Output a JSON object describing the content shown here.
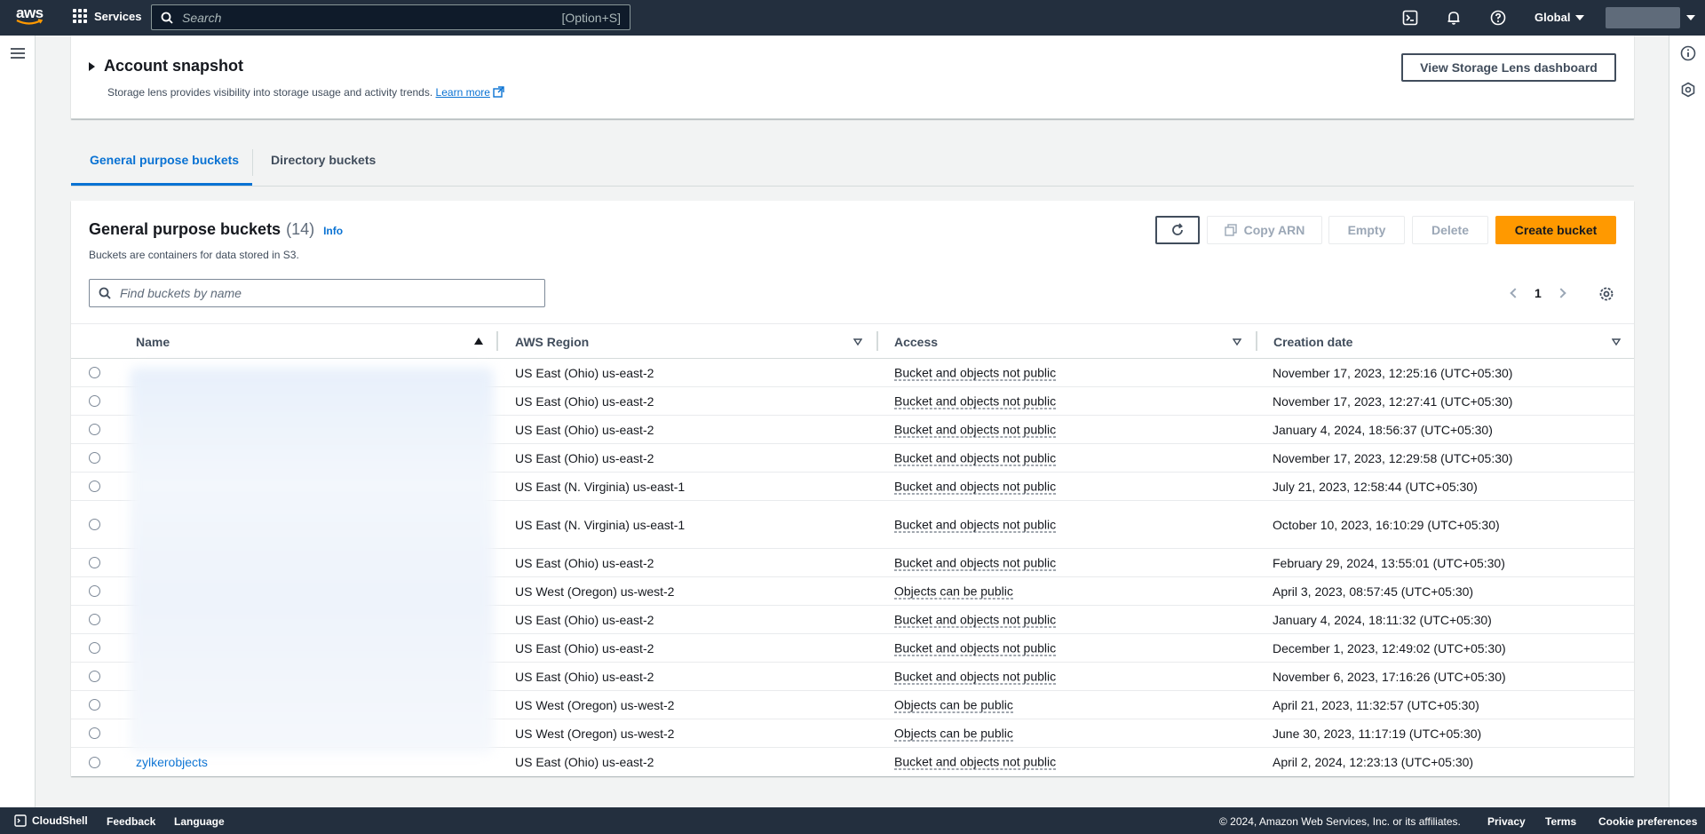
{
  "topnav": {
    "logo_text": "aws",
    "services_label": "Services",
    "search_placeholder": "Search",
    "search_shortcut": "[Option+S]",
    "region_label": "Global"
  },
  "snapshot": {
    "title": "Account snapshot",
    "description": "Storage lens provides visibility into storage usage and activity trends.",
    "learn_more": "Learn more",
    "dashboard_button": "View Storage Lens dashboard"
  },
  "tabs": [
    {
      "label": "General purpose buckets",
      "active": true
    },
    {
      "label": "Directory buckets",
      "active": false
    }
  ],
  "panel": {
    "title": "General purpose buckets",
    "count": "(14)",
    "info": "Info",
    "description": "Buckets are containers for data stored in S3.",
    "filter_placeholder": "Find buckets by name",
    "page": "1",
    "buttons": {
      "copy_arn": "Copy ARN",
      "empty": "Empty",
      "delete": "Delete",
      "create": "Create bucket"
    }
  },
  "table": {
    "columns": [
      "Name",
      "AWS Region",
      "Access",
      "Creation date"
    ],
    "rows": [
      {
        "name": "",
        "region": "US East (Ohio) us-east-2",
        "access": "Bucket and objects not public",
        "created": "November 17, 2023, 12:25:16 (UTC+05:30)"
      },
      {
        "name": "",
        "region": "US East (Ohio) us-east-2",
        "access": "Bucket and objects not public",
        "created": "November 17, 2023, 12:27:41 (UTC+05:30)"
      },
      {
        "name": "",
        "region": "US East (Ohio) us-east-2",
        "access": "Bucket and objects not public",
        "created": "January 4, 2024, 18:56:37 (UTC+05:30)"
      },
      {
        "name": "",
        "region": "US East (Ohio) us-east-2",
        "access": "Bucket and objects not public",
        "created": "November 17, 2023, 12:29:58 (UTC+05:30)"
      },
      {
        "name": "",
        "region": "US East (N. Virginia) us-east-1",
        "access": "Bucket and objects not public",
        "created": "July 21, 2023, 12:58:44 (UTC+05:30)"
      },
      {
        "name": "",
        "region": "US East (N. Virginia) us-east-1",
        "access": "Bucket and objects not public",
        "created": "October 10, 2023, 16:10:29 (UTC+05:30)"
      },
      {
        "name": "",
        "region": "US East (Ohio) us-east-2",
        "access": "Bucket and objects not public",
        "created": "February 29, 2024, 13:55:01 (UTC+05:30)"
      },
      {
        "name": "",
        "region": "US West (Oregon) us-west-2",
        "access": "Objects can be public",
        "created": "April 3, 2023, 08:57:45 (UTC+05:30)"
      },
      {
        "name": "",
        "region": "US East (Ohio) us-east-2",
        "access": "Bucket and objects not public",
        "created": "January 4, 2024, 18:11:32 (UTC+05:30)"
      },
      {
        "name": "",
        "region": "US East (Ohio) us-east-2",
        "access": "Bucket and objects not public",
        "created": "December 1, 2023, 12:49:02 (UTC+05:30)"
      },
      {
        "name": "",
        "region": "US East (Ohio) us-east-2",
        "access": "Bucket and objects not public",
        "created": "November 6, 2023, 17:16:26 (UTC+05:30)"
      },
      {
        "name": "",
        "region": "US West (Oregon) us-west-2",
        "access": "Objects can be public",
        "created": "April 21, 2023, 11:32:57 (UTC+05:30)"
      },
      {
        "name": "",
        "region": "US West (Oregon) us-west-2",
        "access": "Objects can be public",
        "created": "June 30, 2023, 11:17:19 (UTC+05:30)"
      },
      {
        "name": "zylkerobjects",
        "region": "US East (Ohio) us-east-2",
        "access": "Bucket and objects not public",
        "created": "April 2, 2024, 12:23:13 (UTC+05:30)"
      }
    ]
  },
  "footer": {
    "cloudshell": "CloudShell",
    "feedback": "Feedback",
    "language": "Language",
    "copyright": "© 2024, Amazon Web Services, Inc. or its affiliates.",
    "privacy": "Privacy",
    "terms": "Terms",
    "cookie": "Cookie preferences"
  },
  "colors": {
    "nav_bg": "#232f3e",
    "link": "#0972d3",
    "primary_button": "#ff9900"
  }
}
